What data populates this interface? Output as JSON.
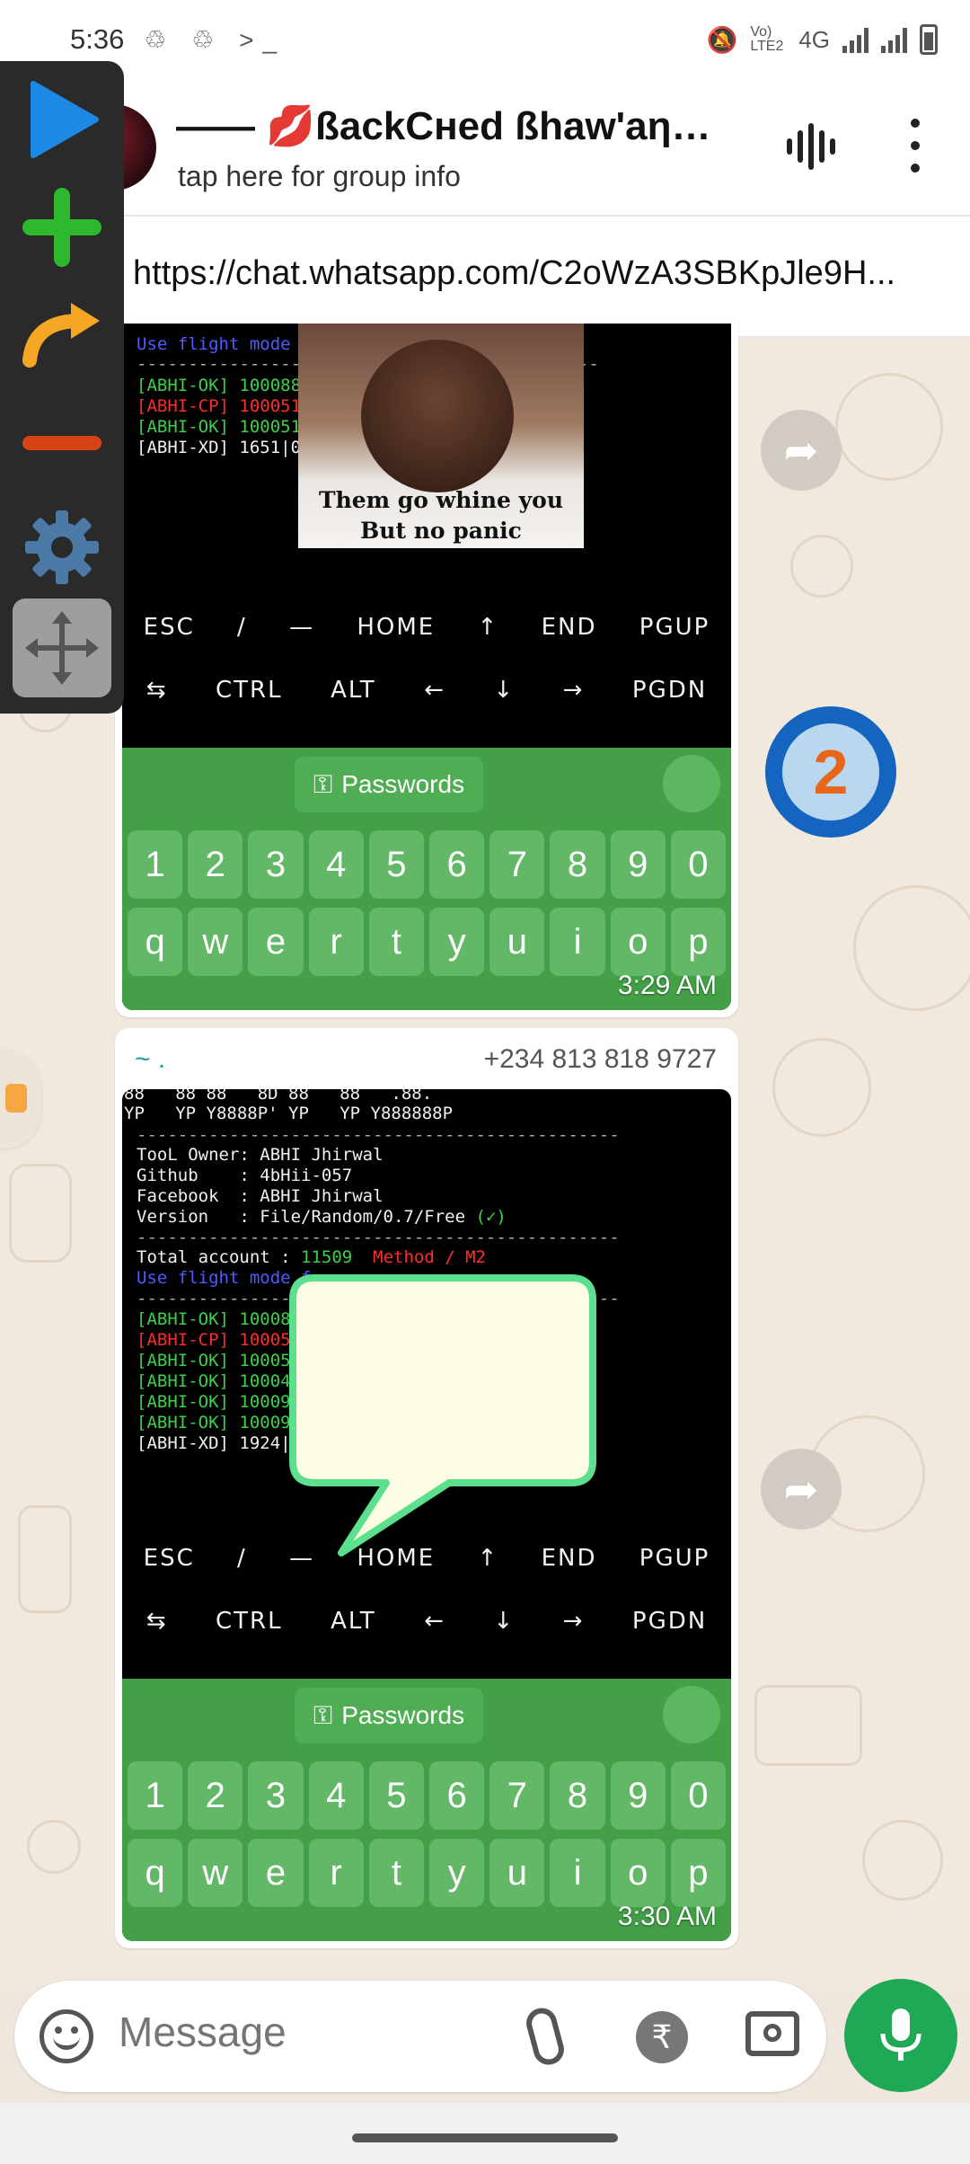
{
  "status_bar": {
    "time": "5:36",
    "left_icons": "♲ ♲ >_",
    "network": "4G",
    "lte_label": "Vo) LTE2"
  },
  "header": {
    "group_name": "—— 💋ßackCнed ßhaw'aη🙈 ...",
    "subtitle": "tap here for group info",
    "voice_icon": "voice-call-icon",
    "menu_icon": "more-vert-icon"
  },
  "pinned": {
    "link": "https://chat.whatsapp.com/C2oWzA3SBKpJle9H..."
  },
  "messages": [
    {
      "terminal_top": {
        "flight_line": "Use flight mode",
        "lines": [
          {
            "text": "[ABHI-OK] 100088",
            "color": "green"
          },
          {
            "text": "[ABHI-CP] 100051",
            "color": "red"
          },
          {
            "text": "[ABHI-OK] 100051",
            "color": "green"
          },
          {
            "text": "[ABHI-XD] 1651|0",
            "color": "white"
          }
        ],
        "meme_caption": "Them go whine you But no panic"
      },
      "extra_keys_row1": [
        "ESC",
        "/",
        "—",
        "HOME",
        "↑",
        "END",
        "PGUP"
      ],
      "extra_keys_row2": [
        "⇆",
        "CTRL",
        "ALT",
        "←",
        "↓",
        "→",
        "PGDN"
      ],
      "passwords_label": "Passwords",
      "number_row": [
        "1",
        "2",
        "3",
        "4",
        "5",
        "6",
        "7",
        "8",
        "9",
        "0"
      ],
      "letter_row": [
        "q",
        "w",
        "e",
        "r",
        "t",
        "y",
        "u",
        "i",
        "o",
        "p"
      ],
      "time": "3:29 AM"
    },
    {
      "sender_name": "~ .",
      "sender_phone": "+234 813 818 9727",
      "terminal": {
        "banner_1": "88   88 88   8D 88   88   .88.",
        "banner_2": "YP   YP Y8888P' YP   YP Y888888P",
        "sep": "-----------------------------------------------",
        "info": [
          "TooL Owner: ABHI Jhirwal",
          "Github    : 4bHii-057",
          "Facebook  : ABHI Jhirwal",
          "Version   : File/Random/0.7/Free"
        ],
        "version_check": "(✓)",
        "total_label": "Total account : ",
        "total_value": "11509",
        "method": "Method / M2",
        "flight": "Use flight mode f",
        "results": [
          {
            "text": "[ABHI-OK] 10008",
            "color": "green"
          },
          {
            "text": "[ABHI-CP] 10005",
            "color": "red"
          },
          {
            "text": "[ABHI-OK] 10005",
            "color": "green"
          },
          {
            "text": "[ABHI-OK] 10004",
            "color": "green"
          },
          {
            "text": "[ABHI-OK] 10009",
            "color": "green"
          },
          {
            "text": "[ABHI-OK] 10009",
            "color": "green"
          },
          {
            "text": "[ABHI-XD] 1924|",
            "color": "white"
          }
        ]
      },
      "extra_keys_row1": [
        "ESC",
        "/",
        "—",
        "HOME",
        "↑",
        "END",
        "PGUP"
      ],
      "extra_keys_row2": [
        "⇆",
        "CTRL",
        "ALT",
        "←",
        "↓",
        "→",
        "PGDN"
      ],
      "passwords_label": "Passwords",
      "number_row": [
        "1",
        "2",
        "3",
        "4",
        "5",
        "6",
        "7",
        "8",
        "9",
        "0"
      ],
      "letter_row": [
        "q",
        "w",
        "e",
        "r",
        "t",
        "y",
        "u",
        "i",
        "o",
        "p"
      ],
      "time": "3:30 AM"
    }
  ],
  "floating_badge": "2",
  "input": {
    "placeholder": "Message",
    "emoji_icon": "emoji-icon",
    "attach_icon": "paperclip-icon",
    "rupee_icon": "rupee-payment-icon",
    "camera_icon": "camera-icon",
    "mic_icon": "mic-icon"
  },
  "colors": {
    "accent_green": "#1fa855",
    "keyboard_green": "#43a047",
    "sender_teal": "#1aa59a"
  }
}
